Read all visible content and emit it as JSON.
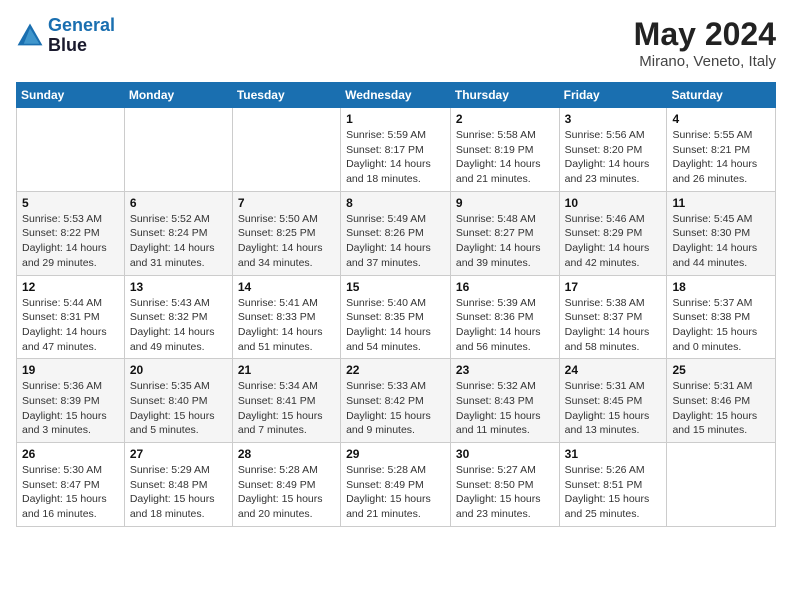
{
  "header": {
    "logo_line1": "General",
    "logo_line2": "Blue",
    "month_title": "May 2024",
    "location": "Mirano, Veneto, Italy"
  },
  "weekdays": [
    "Sunday",
    "Monday",
    "Tuesday",
    "Wednesday",
    "Thursday",
    "Friday",
    "Saturday"
  ],
  "weeks": [
    [
      {
        "day": "",
        "info": ""
      },
      {
        "day": "",
        "info": ""
      },
      {
        "day": "",
        "info": ""
      },
      {
        "day": "1",
        "info": "Sunrise: 5:59 AM\nSunset: 8:17 PM\nDaylight: 14 hours\nand 18 minutes."
      },
      {
        "day": "2",
        "info": "Sunrise: 5:58 AM\nSunset: 8:19 PM\nDaylight: 14 hours\nand 21 minutes."
      },
      {
        "day": "3",
        "info": "Sunrise: 5:56 AM\nSunset: 8:20 PM\nDaylight: 14 hours\nand 23 minutes."
      },
      {
        "day": "4",
        "info": "Sunrise: 5:55 AM\nSunset: 8:21 PM\nDaylight: 14 hours\nand 26 minutes."
      }
    ],
    [
      {
        "day": "5",
        "info": "Sunrise: 5:53 AM\nSunset: 8:22 PM\nDaylight: 14 hours\nand 29 minutes."
      },
      {
        "day": "6",
        "info": "Sunrise: 5:52 AM\nSunset: 8:24 PM\nDaylight: 14 hours\nand 31 minutes."
      },
      {
        "day": "7",
        "info": "Sunrise: 5:50 AM\nSunset: 8:25 PM\nDaylight: 14 hours\nand 34 minutes."
      },
      {
        "day": "8",
        "info": "Sunrise: 5:49 AM\nSunset: 8:26 PM\nDaylight: 14 hours\nand 37 minutes."
      },
      {
        "day": "9",
        "info": "Sunrise: 5:48 AM\nSunset: 8:27 PM\nDaylight: 14 hours\nand 39 minutes."
      },
      {
        "day": "10",
        "info": "Sunrise: 5:46 AM\nSunset: 8:29 PM\nDaylight: 14 hours\nand 42 minutes."
      },
      {
        "day": "11",
        "info": "Sunrise: 5:45 AM\nSunset: 8:30 PM\nDaylight: 14 hours\nand 44 minutes."
      }
    ],
    [
      {
        "day": "12",
        "info": "Sunrise: 5:44 AM\nSunset: 8:31 PM\nDaylight: 14 hours\nand 47 minutes."
      },
      {
        "day": "13",
        "info": "Sunrise: 5:43 AM\nSunset: 8:32 PM\nDaylight: 14 hours\nand 49 minutes."
      },
      {
        "day": "14",
        "info": "Sunrise: 5:41 AM\nSunset: 8:33 PM\nDaylight: 14 hours\nand 51 minutes."
      },
      {
        "day": "15",
        "info": "Sunrise: 5:40 AM\nSunset: 8:35 PM\nDaylight: 14 hours\nand 54 minutes."
      },
      {
        "day": "16",
        "info": "Sunrise: 5:39 AM\nSunset: 8:36 PM\nDaylight: 14 hours\nand 56 minutes."
      },
      {
        "day": "17",
        "info": "Sunrise: 5:38 AM\nSunset: 8:37 PM\nDaylight: 14 hours\nand 58 minutes."
      },
      {
        "day": "18",
        "info": "Sunrise: 5:37 AM\nSunset: 8:38 PM\nDaylight: 15 hours\nand 0 minutes."
      }
    ],
    [
      {
        "day": "19",
        "info": "Sunrise: 5:36 AM\nSunset: 8:39 PM\nDaylight: 15 hours\nand 3 minutes."
      },
      {
        "day": "20",
        "info": "Sunrise: 5:35 AM\nSunset: 8:40 PM\nDaylight: 15 hours\nand 5 minutes."
      },
      {
        "day": "21",
        "info": "Sunrise: 5:34 AM\nSunset: 8:41 PM\nDaylight: 15 hours\nand 7 minutes."
      },
      {
        "day": "22",
        "info": "Sunrise: 5:33 AM\nSunset: 8:42 PM\nDaylight: 15 hours\nand 9 minutes."
      },
      {
        "day": "23",
        "info": "Sunrise: 5:32 AM\nSunset: 8:43 PM\nDaylight: 15 hours\nand 11 minutes."
      },
      {
        "day": "24",
        "info": "Sunrise: 5:31 AM\nSunset: 8:45 PM\nDaylight: 15 hours\nand 13 minutes."
      },
      {
        "day": "25",
        "info": "Sunrise: 5:31 AM\nSunset: 8:46 PM\nDaylight: 15 hours\nand 15 minutes."
      }
    ],
    [
      {
        "day": "26",
        "info": "Sunrise: 5:30 AM\nSunset: 8:47 PM\nDaylight: 15 hours\nand 16 minutes."
      },
      {
        "day": "27",
        "info": "Sunrise: 5:29 AM\nSunset: 8:48 PM\nDaylight: 15 hours\nand 18 minutes."
      },
      {
        "day": "28",
        "info": "Sunrise: 5:28 AM\nSunset: 8:49 PM\nDaylight: 15 hours\nand 20 minutes."
      },
      {
        "day": "29",
        "info": "Sunrise: 5:28 AM\nSunset: 8:49 PM\nDaylight: 15 hours\nand 21 minutes."
      },
      {
        "day": "30",
        "info": "Sunrise: 5:27 AM\nSunset: 8:50 PM\nDaylight: 15 hours\nand 23 minutes."
      },
      {
        "day": "31",
        "info": "Sunrise: 5:26 AM\nSunset: 8:51 PM\nDaylight: 15 hours\nand 25 minutes."
      },
      {
        "day": "",
        "info": ""
      }
    ]
  ]
}
